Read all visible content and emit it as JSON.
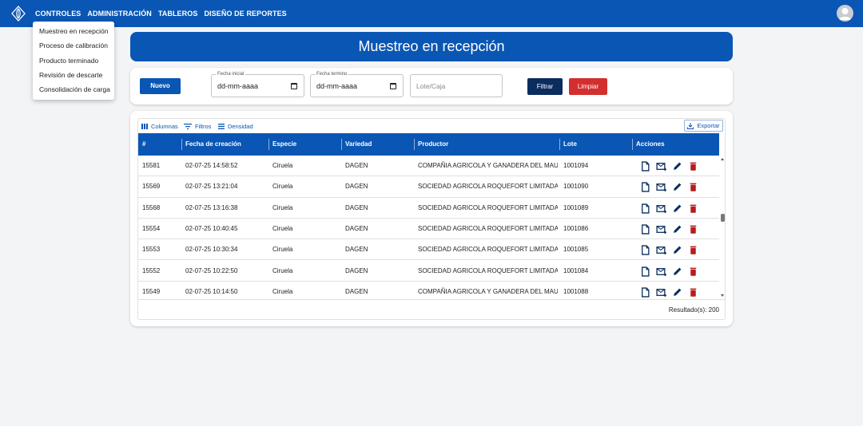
{
  "nav": {
    "items": [
      "CONTROLES",
      "ADMINISTRACIÓN",
      "TABLEROS",
      "DISEÑO DE REPORTES"
    ]
  },
  "menu": {
    "items": [
      "Muestreo en recepción",
      "Proceso de calibración",
      "Producto terminado",
      "Revisión de descarte",
      "Consolidación de carga"
    ]
  },
  "page": {
    "title": "Muestreo en recepción"
  },
  "filters": {
    "new_label": "Nuevo",
    "start_date": {
      "label": "Fecha inicial",
      "value": "dd-mm-aaaa"
    },
    "end_date": {
      "label": "Fecha termino",
      "value": "dd-mm-aaaa"
    },
    "lot": {
      "placeholder": "Lote/Caja"
    },
    "filter_label": "Filtrar",
    "clear_label": "Limpiar"
  },
  "toolbar": {
    "columns_label": "Columnas",
    "filters_label": "Filtros",
    "density_label": "Densidad",
    "export_label": "Exportar"
  },
  "table": {
    "headers": [
      "#",
      "Fecha de creación",
      "Especie",
      "Variedad",
      "Productor",
      "Lote",
      "Acciones"
    ],
    "rows": [
      [
        "15581",
        "02-07-25 14:58:52",
        "Ciruela",
        "DAGEN",
        "COMPAÑIA AGRICOLA Y GANADERA DEL MAUL...",
        "1001094"
      ],
      [
        "15569",
        "02-07-25 13:21:04",
        "Ciruela",
        "DAGEN",
        "SOCIEDAD AGRICOLA ROQUEFORT LIMITADA",
        "1001090"
      ],
      [
        "15568",
        "02-07-25 13:16:38",
        "Ciruela",
        "DAGEN",
        "SOCIEDAD AGRICOLA ROQUEFORT LIMITADA",
        "1001089"
      ],
      [
        "15554",
        "02-07-25 10:40:45",
        "Ciruela",
        "DAGEN",
        "SOCIEDAD AGRICOLA ROQUEFORT LIMITADA",
        "1001086"
      ],
      [
        "15553",
        "02-07-25 10:30:34",
        "Ciruela",
        "DAGEN",
        "SOCIEDAD AGRICOLA ROQUEFORT LIMITADA",
        "1001085"
      ],
      [
        "15552",
        "02-07-25 10:22:50",
        "Ciruela",
        "DAGEN",
        "SOCIEDAD AGRICOLA ROQUEFORT LIMITADA",
        "1001084"
      ],
      [
        "15549",
        "02-07-25 10:14:50",
        "Ciruela",
        "DAGEN",
        "COMPAÑIA AGRICOLA Y GANADERA DEL MAUL...",
        "1001088"
      ]
    ],
    "result_text": "Resultado(s): 200"
  },
  "colors": {
    "primary": "#0a56b4",
    "dark_button": "#0b2d5e",
    "danger": "#d32f2f",
    "delete_icon": "#b71c1c",
    "action_icon": "#0b2d5e"
  }
}
